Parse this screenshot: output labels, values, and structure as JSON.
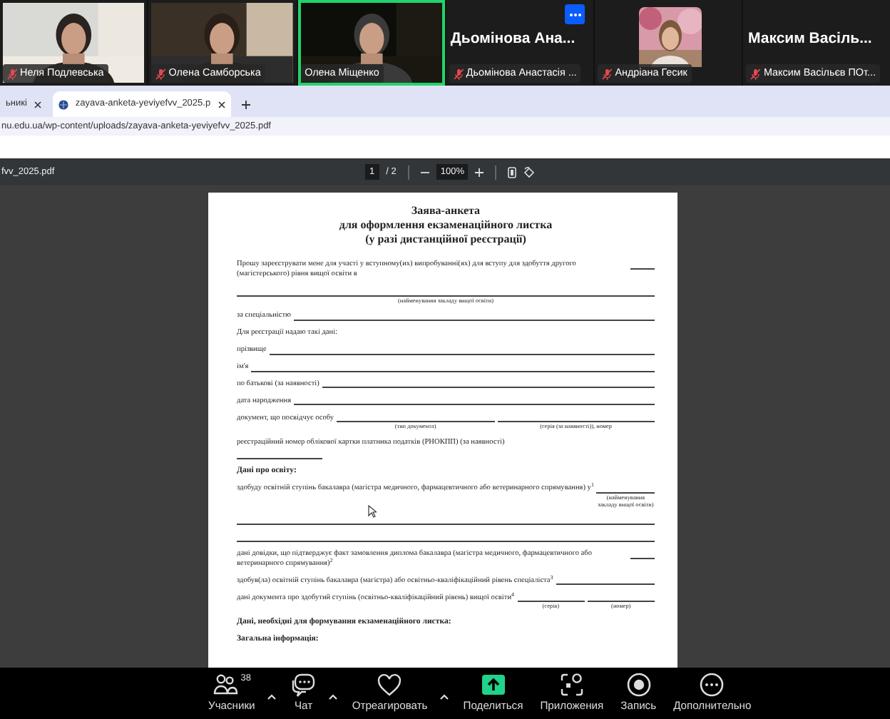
{
  "participants": [
    {
      "kind": "video",
      "name": "Неля Подлевська",
      "muted": true,
      "speaking": false,
      "menu": false
    },
    {
      "kind": "video",
      "name": "Олена Самборська",
      "muted": true,
      "speaking": false,
      "menu": false
    },
    {
      "kind": "video",
      "name": "Олена Міщенко",
      "muted": false,
      "speaking": true,
      "menu": false
    },
    {
      "kind": "name",
      "display_name": "Дьомінова Ана...",
      "name": "Дьомінова Анастасія ...",
      "muted": true,
      "speaking": false,
      "menu": true
    },
    {
      "kind": "avatar",
      "name": "Андріана Гесик",
      "muted": true,
      "speaking": false,
      "menu": false
    },
    {
      "kind": "name",
      "display_name": "Максим Васіль...",
      "name": "Максим Васільєв ПОт...",
      "muted": true,
      "speaking": false,
      "menu": false
    }
  ],
  "browser": {
    "tabs": [
      {
        "title": "ьникі",
        "selected": false
      },
      {
        "title": "zayava-anketa-yeviyefvv_2025.p",
        "selected": true
      }
    ],
    "address": "nu.edu.ua/wp-content/uploads/zayava-anketa-yeviyefvv_2025.pdf"
  },
  "pdf_toolbar": {
    "file": "fvv_2025.pdf",
    "page": "1",
    "pages": "/ 2",
    "zoom": "100%"
  },
  "document": {
    "title": [
      "Заява-анкета",
      "для оформлення екзаменаційного листка",
      "(у разі дистанційної реєстрації)"
    ],
    "blocks": [
      {
        "kind": "fill",
        "text": "Прошу зареєструвати мене для участі у вступному(их) випробуванні(ях) для вступу для здобуття другого (магістерського) рівня вищої освіти в"
      },
      {
        "kind": "line",
        "captions": [
          "(найменування закладу вищої освіти)"
        ]
      },
      {
        "kind": "fill",
        "text": "за спеціальністю"
      },
      {
        "kind": "text",
        "text": "Для реєстрації надаю такі дані:"
      },
      {
        "kind": "fill",
        "text": "прізвище"
      },
      {
        "kind": "fill",
        "text": "ім'я"
      },
      {
        "kind": "fill",
        "text": "по батькові (за наявності)"
      },
      {
        "kind": "fill",
        "text": "дата народження"
      },
      {
        "kind": "fill",
        "text": "документ, що посвідчує особу",
        "captions": [
          "(тип документа)",
          "(серія (за наявності)), номер"
        ]
      },
      {
        "kind": "text",
        "text": "реєстраційний номер облікової картки платника податків (РНОКПП) (за наявності)"
      },
      {
        "kind": "stub"
      },
      {
        "kind": "heading",
        "text": "Дані про освіту:"
      },
      {
        "kind": "fill",
        "text": "здобуду освітній ступінь бакалавра (магістра медичного, фармацевтичного або ветеринарного спрямування) у$^{1}$",
        "captions": [
          "(найменування закладу вищої освіти)"
        ]
      },
      {
        "kind": "line"
      },
      {
        "kind": "line"
      },
      {
        "kind": "fill",
        "text": "дані довідки, що підтверджує факт замовлення диплома бакалавра (магістра медичного, фармацевтичного або ветеринарного спрямування)$^{2}$"
      },
      {
        "kind": "fill",
        "text": "здобув(ла) освітній ступінь бакалавра (магістра) або освітньо-кваліфікаційний рівень спеціаліста$^{3}$"
      },
      {
        "kind": "fill",
        "text": "дані документа про здобутий ступінь (освітньо-кваліфікаційний рівень) вищої освіти$^{4}$",
        "captions": [
          "(серія)",
          "(номер)"
        ]
      },
      {
        "kind": "heading",
        "text": "Дані, необхідні для формування екзаменаційного листка:"
      },
      {
        "kind": "heading",
        "text": "Загальна інформація:"
      }
    ]
  },
  "toolbar": [
    {
      "kind": "participants",
      "label": "Учасники",
      "count": "38",
      "caret": true
    },
    {
      "kind": "chat",
      "label": "Чат",
      "caret": true
    },
    {
      "kind": "react",
      "label": "Отреагировать",
      "caret": true
    },
    {
      "kind": "share",
      "label": "Поделиться",
      "caret": false
    },
    {
      "kind": "apps",
      "label": "Приложения",
      "caret": false
    },
    {
      "kind": "record",
      "label": "Запись",
      "caret": false
    },
    {
      "kind": "more",
      "label": "Дополнительно",
      "caret": false
    }
  ]
}
